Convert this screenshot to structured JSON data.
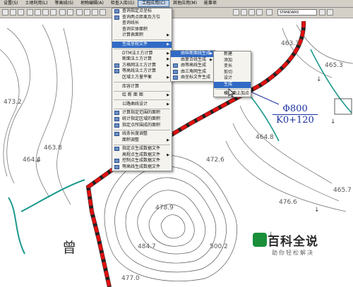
{
  "menubar": {
    "items": [
      "设置(S)",
      "土地利用(L)",
      "等高线(S)",
      "地物编辑(A)",
      "检查入库(G)",
      "工程应用(C)",
      "其他应用(M)",
      "能事项"
    ],
    "active_index": 5
  },
  "toolbar": {
    "style_value": "STANDARD"
  },
  "menu_main": {
    "items": [
      {
        "label": "查询指定点坐标",
        "icon": true
      },
      {
        "label": "查询两点距离及方位",
        "icon": true
      },
      {
        "label": "查询线长"
      },
      {
        "label": "查询实体面积"
      },
      {
        "label": "计算表面积",
        "arrow": true
      },
      {
        "sep": true
      },
      {
        "label": "生成里程文件",
        "arrow": true,
        "selected": true
      },
      {
        "sep": true
      },
      {
        "label": "DTM法土方计算",
        "arrow": true
      },
      {
        "label": "断面法土方计算",
        "arrow": true
      },
      {
        "label": "方格网法土方计算",
        "arrow": true,
        "icon": true
      },
      {
        "label": "等高线法土方计算",
        "icon": true
      },
      {
        "label": "区域土方量平衡",
        "arrow": true
      },
      {
        "sep": true
      },
      {
        "label": "库容计算"
      },
      {
        "sep": true
      },
      {
        "label": "绘 断 面 图",
        "arrow": true
      },
      {
        "sep": true
      },
      {
        "label": "公路曲线设计",
        "arrow": true
      },
      {
        "sep": true
      },
      {
        "label": "计算指定范围的面积",
        "icon": true
      },
      {
        "label": "统计指定区域的面积",
        "icon": true
      },
      {
        "label": "指定点所围成的面积",
        "icon": true
      },
      {
        "sep": true
      },
      {
        "label": "线条长度调整",
        "icon": true
      },
      {
        "label": "面积调整",
        "arrow": true
      },
      {
        "sep": true
      },
      {
        "label": "指定点生成数据文件",
        "icon": true
      },
      {
        "label": "高程点生成数据文件",
        "arrow": true
      },
      {
        "label": "控制点生成数据文件",
        "icon": true
      },
      {
        "label": "等高线生成数据文件",
        "icon": true
      }
    ]
  },
  "menu_sub1": {
    "items": [
      {
        "label": "由纵断面线生成",
        "arrow": true,
        "selected": true
      },
      {
        "label": "由复合线生成",
        "arrow": true
      },
      {
        "label": "由等高线生成",
        "icon": true
      },
      {
        "label": "由三角网生成",
        "icon": true
      },
      {
        "label": "由坐标文件生成",
        "icon": true
      }
    ]
  },
  "menu_sub2": {
    "items": [
      {
        "label": "新建"
      },
      {
        "label": "添加"
      },
      {
        "label": "变长"
      },
      {
        "label": "剪切"
      },
      {
        "label": "设计"
      },
      {
        "label": "生成",
        "selected": true
      },
      {
        "sep": true
      },
      {
        "label": "横断面上加点"
      }
    ]
  },
  "map": {
    "elevation_labels": [
      "463.3",
      "465.3",
      "473.2",
      "463.8",
      "464.4",
      "464.8",
      "465.7",
      "476.6",
      "478.9",
      "472.6",
      "484.7",
      "500.2",
      "477.0"
    ],
    "pipe_diameter": "Φ800",
    "pipe_station": "K0+120",
    "glyph": "曾"
  },
  "watermark": {
    "title": "百科全说",
    "subtitle": "助你轻松解决"
  },
  "colors": {
    "menu_bg": "#f4f3ee",
    "highlight": "#316ac5",
    "road_red": "#e01010",
    "teal": "#1b9a8c"
  }
}
